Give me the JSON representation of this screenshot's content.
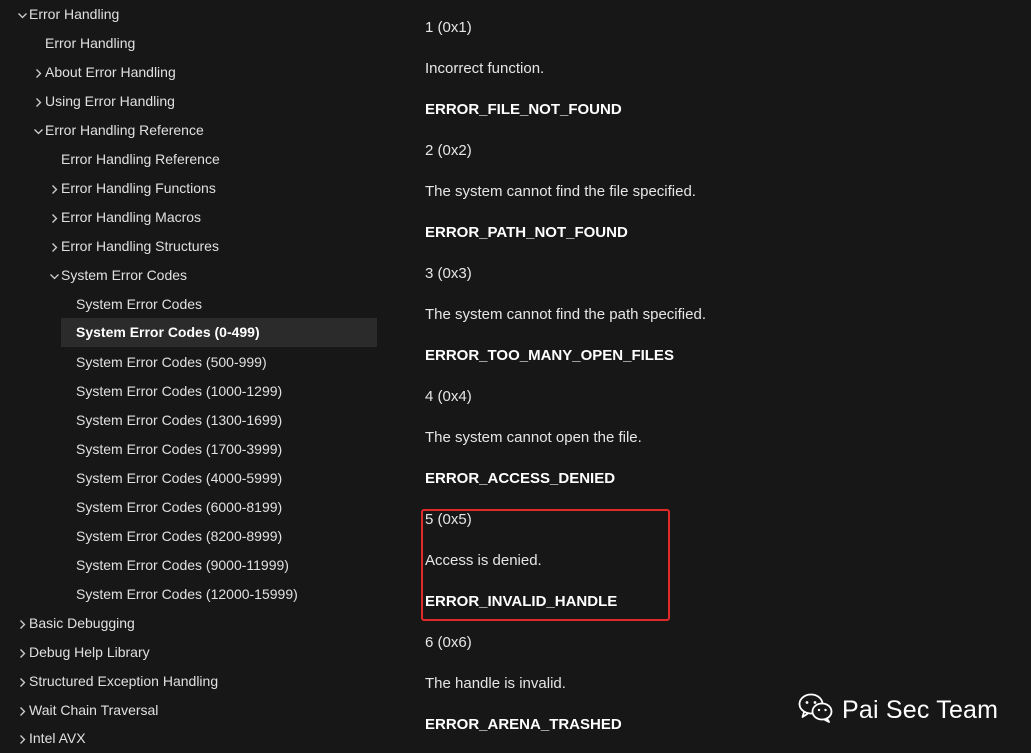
{
  "nav": {
    "items": [
      {
        "label": "Error Handling",
        "chevron": "down"
      },
      {
        "label": "Error Handling",
        "chevron": "none"
      },
      {
        "label": "About Error Handling",
        "chevron": "right"
      },
      {
        "label": "Using Error Handling",
        "chevron": "right"
      },
      {
        "label": "Error Handling Reference",
        "chevron": "down"
      },
      {
        "label": "Error Handling Reference",
        "chevron": "none"
      },
      {
        "label": "Error Handling Functions",
        "chevron": "right"
      },
      {
        "label": "Error Handling Macros",
        "chevron": "right"
      },
      {
        "label": "Error Handling Structures",
        "chevron": "right"
      },
      {
        "label": "System Error Codes",
        "chevron": "down"
      },
      {
        "label": "System Error Codes",
        "chevron": "none"
      },
      {
        "label": "System Error Codes (0-499)",
        "chevron": "none",
        "selected": true
      },
      {
        "label": "System Error Codes (500-999)",
        "chevron": "none"
      },
      {
        "label": "System Error Codes (1000-1299)",
        "chevron": "none"
      },
      {
        "label": "System Error Codes (1300-1699)",
        "chevron": "none"
      },
      {
        "label": "System Error Codes (1700-3999)",
        "chevron": "none"
      },
      {
        "label": "System Error Codes (4000-5999)",
        "chevron": "none"
      },
      {
        "label": "System Error Codes (6000-8199)",
        "chevron": "none"
      },
      {
        "label": "System Error Codes (8200-8999)",
        "chevron": "none"
      },
      {
        "label": "System Error Codes (9000-11999)",
        "chevron": "none"
      },
      {
        "label": "System Error Codes (12000-15999)",
        "chevron": "none"
      },
      {
        "label": "Basic Debugging",
        "chevron": "right"
      },
      {
        "label": "Debug Help Library",
        "chevron": "right"
      },
      {
        "label": "Structured Exception Handling",
        "chevron": "right"
      },
      {
        "label": "Wait Chain Traversal",
        "chevron": "right"
      },
      {
        "label": "Intel AVX",
        "chevron": "right"
      }
    ]
  },
  "content": {
    "lines": [
      {
        "text": "1 (0x1)",
        "kind": "value"
      },
      {
        "text": "Incorrect function.",
        "kind": "desc"
      },
      {
        "text": "ERROR_FILE_NOT_FOUND",
        "kind": "code"
      },
      {
        "text": "2 (0x2)",
        "kind": "value"
      },
      {
        "text": "The system cannot find the file specified.",
        "kind": "desc"
      },
      {
        "text": "ERROR_PATH_NOT_FOUND",
        "kind": "code"
      },
      {
        "text": "3 (0x3)",
        "kind": "value"
      },
      {
        "text": "The system cannot find the path specified.",
        "kind": "desc"
      },
      {
        "text": "ERROR_TOO_MANY_OPEN_FILES",
        "kind": "code"
      },
      {
        "text": "4 (0x4)",
        "kind": "value"
      },
      {
        "text": "The system cannot open the file.",
        "kind": "desc"
      },
      {
        "text": "ERROR_ACCESS_DENIED",
        "kind": "code"
      },
      {
        "text": "5 (0x5)",
        "kind": "value"
      },
      {
        "text": "Access is denied.",
        "kind": "desc"
      },
      {
        "text": "ERROR_INVALID_HANDLE",
        "kind": "code"
      },
      {
        "text": "6 (0x6)",
        "kind": "value"
      },
      {
        "text": "The handle is invalid.",
        "kind": "desc"
      },
      {
        "text": "ERROR_ARENA_TRASHED",
        "kind": "code"
      }
    ]
  },
  "highlight": {
    "color": "#e02a2a"
  },
  "watermark": {
    "icon": "wechat-icon",
    "text": "Pai Sec Team"
  },
  "colors": {
    "background": "#171717",
    "selected_row": "#2b2b2b",
    "text": "#e6e6e6"
  }
}
